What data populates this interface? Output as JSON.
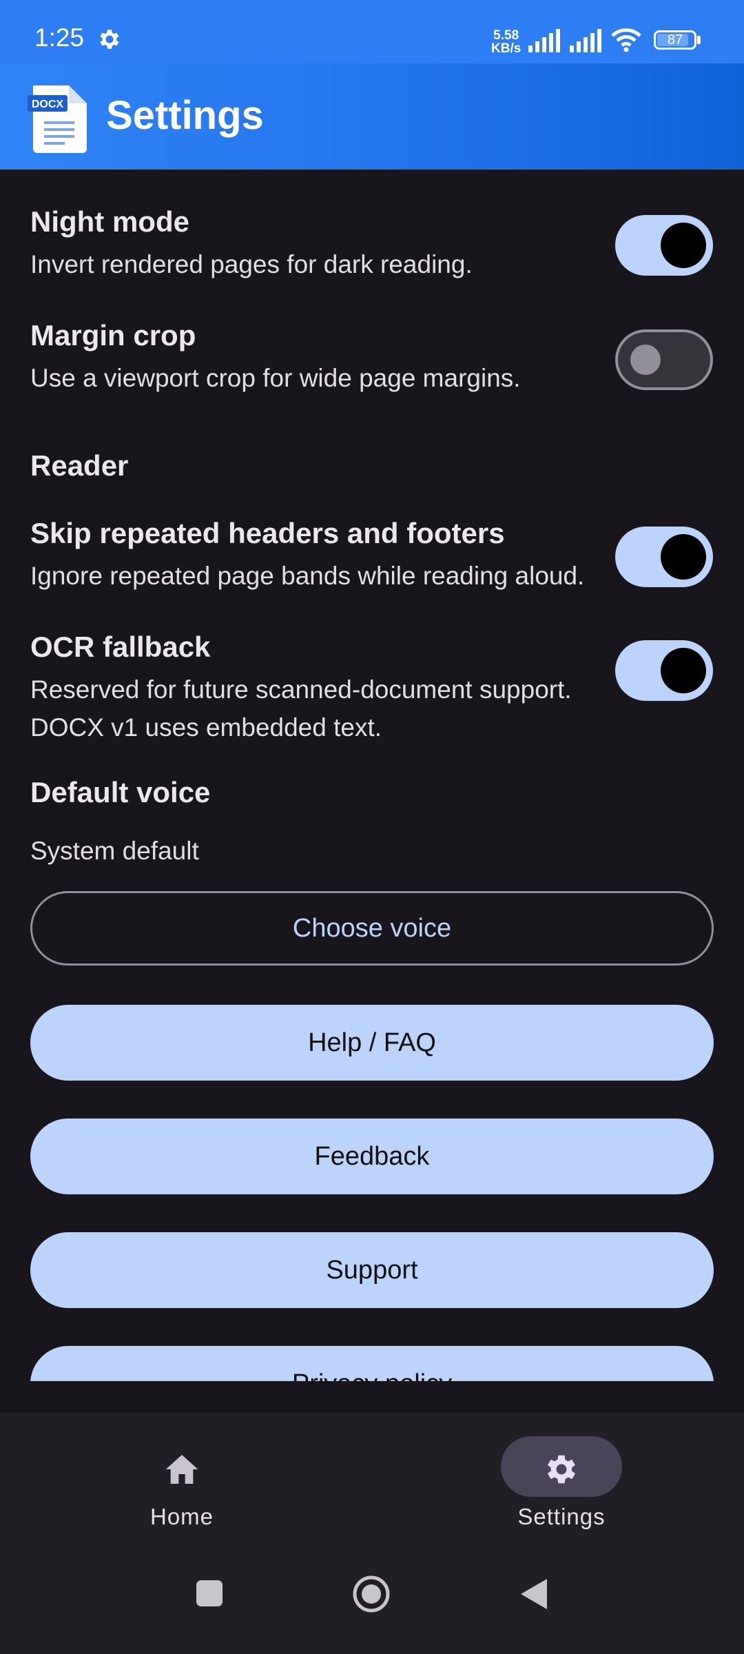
{
  "status_bar": {
    "time": "1:25",
    "speed_value": "5.58",
    "speed_unit": "KB/s",
    "battery": "87",
    "battery_level": 0.87
  },
  "app_bar": {
    "logo_badge": "DOCX",
    "title": "Settings"
  },
  "settings": {
    "night_mode": {
      "title": "Night mode",
      "subtitle": "Invert rendered pages for dark reading.",
      "enabled": true
    },
    "margin_crop": {
      "title": "Margin crop",
      "subtitle": "Use a viewport crop for wide page margins.",
      "enabled": false
    },
    "reader_section": "Reader",
    "skip_headers": {
      "title": "Skip repeated headers and footers",
      "subtitle": "Ignore repeated page bands while reading aloud.",
      "enabled": true
    },
    "ocr_fallback": {
      "title": "OCR fallback",
      "subtitle_line1": "Reserved for future scanned-document support.",
      "subtitle_line2": "DOCX v1 uses embedded text.",
      "enabled": true
    },
    "default_voice": {
      "title": "Default voice",
      "value": "System default",
      "button": "Choose voice"
    }
  },
  "buttons": {
    "help": "Help / FAQ",
    "feedback": "Feedback",
    "support": "Support",
    "privacy": "Privacy policy"
  },
  "bottom_nav": {
    "items": [
      {
        "label": "Home",
        "icon": "home-icon",
        "active": false
      },
      {
        "label": "Settings",
        "icon": "gear-icon",
        "active": true
      }
    ]
  },
  "colors": {
    "accent": "#bcd4fb",
    "app_bar": "#2d7ef2",
    "background": "#18161c"
  }
}
